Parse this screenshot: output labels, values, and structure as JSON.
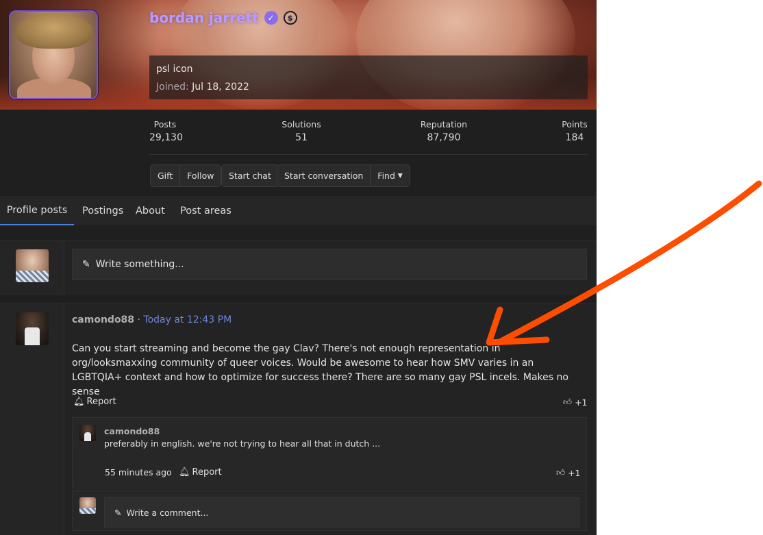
{
  "profile": {
    "username": "bordan jarrett",
    "title": "psl icon",
    "joined_label": "Joined:",
    "joined_date": "Jul 18, 2022"
  },
  "stats": [
    {
      "label": "Posts",
      "value": "29,130"
    },
    {
      "label": "Solutions",
      "value": "51"
    },
    {
      "label": "Reputation",
      "value": "87,790"
    },
    {
      "label": "Points",
      "value": "184"
    }
  ],
  "buttons": {
    "gift": "Gift",
    "follow": "Follow",
    "start_chat": "Start chat",
    "start_conversation": "Start conversation",
    "find": "Find"
  },
  "tabs": [
    "Profile posts",
    "Postings",
    "About",
    "Post areas"
  ],
  "composer": {
    "placeholder": "Write something..."
  },
  "post": {
    "author": "camondo88",
    "separator": "·",
    "time": "Today at 12:43 PM",
    "body": "Can you start streaming and become the gay Clav? There's not enough representation in org/looksmaxxing community of queer voices. Would be awesome to hear how SMV varies in an LGBTQIA+ context and how to optimize for success there? There are so many gay PSL incels. Makes no sense",
    "report": "Report",
    "likes": "+1"
  },
  "comment": {
    "author": "camondo88",
    "text": "preferably in english. we're not trying to hear all that in dutch ...",
    "time": "55 minutes ago",
    "report": "Report",
    "likes": "+1"
  },
  "comment_composer": {
    "placeholder": "Write a comment..."
  },
  "colors": {
    "username": "#b79cff",
    "accent_tab": "#4c7fd6",
    "timestamp": "#6e87d6",
    "annotation_arrow": "#ff4d00"
  }
}
